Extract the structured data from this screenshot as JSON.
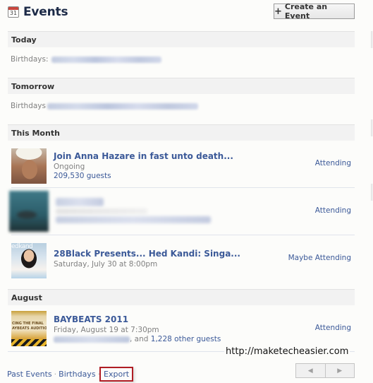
{
  "header": {
    "icon_day": "31",
    "title": "Events",
    "create_button": {
      "icon": "plus-icon",
      "symbol": "+",
      "label": "Create an Event"
    }
  },
  "sections": {
    "today": {
      "heading": "Today",
      "birthdays_label": "Birthdays:"
    },
    "tomorrow": {
      "heading": "Tomorrow",
      "birthdays_label": "Birthdays"
    },
    "this_month": {
      "heading": "This Month",
      "events": [
        {
          "title": "Join Anna Hazare in fast unto death...",
          "subtitle": "Ongoing",
          "guests": "209,530 guests",
          "rsvp": "Attending"
        },
        {
          "title": "",
          "subtitle": "",
          "guests": "",
          "rsvp": "Attending"
        },
        {
          "title": "28Black Presents... Hed Kandi: Singa...",
          "subtitle": "Saturday, July 30 at 8:00pm",
          "thumb_text": "edkand",
          "rsvp": "Maybe Attending"
        }
      ]
    },
    "august": {
      "heading": "August",
      "events": [
        {
          "title": "BAYBEATS 2011",
          "subtitle": "Friday, August 19 at 7:30pm",
          "guests_suffix": ", and ",
          "guests_count": "1,228 other guests",
          "thumb_text_1": "CING THE FINAL",
          "thumb_text_2": "AYBEATS AUDITION",
          "rsvp": "Attending"
        }
      ]
    }
  },
  "footer": {
    "links": [
      "Past Events",
      "Birthdays",
      "Export"
    ],
    "separator": "·",
    "highlight_color": "#b01d24",
    "pager": {
      "prev_symbol": "◀",
      "next_symbol": "▶"
    }
  },
  "watermark": "http://maketecheasier.com",
  "colors": {
    "link": "#3b5998",
    "title": "#1c2a47",
    "section_bg": "#f2f2f2",
    "muted_text": "#808080"
  }
}
